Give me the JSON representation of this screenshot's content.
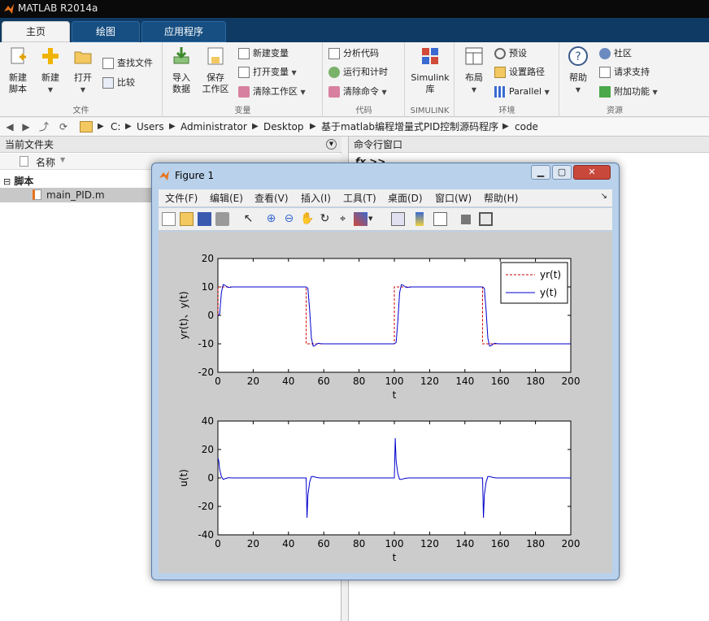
{
  "app": {
    "title": "MATLAB R2014a"
  },
  "tabs": [
    {
      "label": "主页"
    },
    {
      "label": "绘图"
    },
    {
      "label": "应用程序"
    }
  ],
  "ribbon": {
    "file": {
      "label": "文件",
      "new_script": "新建\n脚本",
      "new": "新建",
      "open": "打开",
      "find_files": "查找文件",
      "compare": "比较"
    },
    "variable": {
      "label": "变量",
      "import": "导入\n数据",
      "save_ws": "保存\n工作区",
      "new_var": "新建变量",
      "open_var": "打开变量",
      "clear_ws": "清除工作区"
    },
    "code": {
      "label": "代码",
      "analyze": "分析代码",
      "run_time": "运行和计时",
      "clear_cmd": "清除命令"
    },
    "simulink": {
      "label": "SIMULINK",
      "lib": "Simulink\n库"
    },
    "env": {
      "label": "环境",
      "layout": "布局",
      "prefs": "预设",
      "set_path": "设置路径",
      "parallel": "Parallel"
    },
    "resources": {
      "label": "资源",
      "help": "帮助",
      "community": "社区",
      "support": "请求支持",
      "addons": "附加功能"
    }
  },
  "address": {
    "crumbs": [
      "C:",
      "Users",
      "Administrator",
      "Desktop",
      "基于matlab编程增量式PID控制源码程序",
      "code"
    ]
  },
  "current_folder": {
    "title": "当前文件夹",
    "col_name": "名称",
    "group": "脚本",
    "file": "main_PID.m"
  },
  "command_window": {
    "title": "命令行窗口",
    "prompt": "fx >>"
  },
  "figure": {
    "title": "Figure 1",
    "menus": [
      "文件(F)",
      "编辑(E)",
      "查看(V)",
      "插入(I)",
      "工具(T)",
      "桌面(D)",
      "窗口(W)",
      "帮助(H)"
    ]
  },
  "colors": {
    "ref": "#cc0000",
    "out": "#0000cc",
    "plotbg": "#cccccc"
  },
  "chart_data": [
    {
      "type": "line",
      "xlabel": "t",
      "ylabel": "yr(t)、y(t)",
      "xlim": [
        0,
        200
      ],
      "ylim": [
        -20,
        20
      ],
      "xticks": [
        0,
        20,
        40,
        60,
        80,
        100,
        120,
        140,
        160,
        180,
        200
      ],
      "yticks": [
        -20,
        -10,
        0,
        10,
        20
      ],
      "legend": {
        "position": "top-right",
        "entries": [
          "yr(t)",
          "y(t)"
        ]
      },
      "series": [
        {
          "name": "yr(t)",
          "style": "dashed",
          "color": "#cc0000",
          "x": [
            0,
            0,
            50,
            50,
            100,
            100,
            150,
            150,
            200
          ],
          "y": [
            0,
            10,
            10,
            -10,
            -10,
            10,
            10,
            -10,
            -10
          ]
        },
        {
          "name": "y(t)",
          "style": "solid",
          "color": "#0000cc",
          "x": [
            0,
            1,
            2,
            3,
            4,
            5,
            6,
            7,
            8,
            10,
            50,
            51,
            52,
            53,
            54,
            55,
            56,
            57,
            58,
            60,
            100,
            101,
            102,
            103,
            104,
            105,
            106,
            107,
            108,
            110,
            150,
            151,
            152,
            153,
            154,
            155,
            156,
            157,
            158,
            160,
            200
          ],
          "y": [
            0,
            0.5,
            8,
            10.8,
            10.6,
            10.1,
            9.8,
            9.9,
            10,
            10,
            10,
            9.5,
            2,
            -8,
            -10.8,
            -10.6,
            -10.1,
            -9.8,
            -9.9,
            -10,
            -10,
            -9.5,
            -2,
            8,
            10.8,
            10.6,
            10.1,
            9.8,
            9.9,
            10,
            10,
            9.5,
            2,
            -8,
            -10.8,
            -10.6,
            -10.1,
            -9.8,
            -9.9,
            -10,
            -10
          ]
        }
      ]
    },
    {
      "type": "line",
      "xlabel": "t",
      "ylabel": "u(t)",
      "xlim": [
        0,
        200
      ],
      "ylim": [
        -40,
        40
      ],
      "xticks": [
        0,
        20,
        40,
        60,
        80,
        100,
        120,
        140,
        160,
        180,
        200
      ],
      "yticks": [
        -40,
        -20,
        0,
        20,
        40
      ],
      "series": [
        {
          "name": "",
          "style": "solid",
          "color": "#0000cc",
          "x": [
            0,
            0.5,
            1,
            2,
            3,
            4,
            6,
            8,
            10,
            50,
            50.5,
            51,
            52,
            53,
            54,
            56,
            58,
            60,
            100,
            100.5,
            101,
            102,
            103,
            104,
            106,
            108,
            110,
            150,
            150.5,
            151,
            152,
            153,
            154,
            156,
            158,
            160,
            200
          ],
          "y": [
            14,
            12,
            6,
            1,
            -1,
            -0.5,
            0.2,
            0,
            0,
            0,
            -28,
            -12,
            -3,
            1,
            1,
            0.3,
            0,
            0,
            0,
            28,
            12,
            3,
            -1,
            -1,
            -0.3,
            0,
            0,
            0,
            -28,
            -12,
            -3,
            1,
            1,
            0.3,
            0,
            0,
            0
          ]
        }
      ]
    }
  ]
}
